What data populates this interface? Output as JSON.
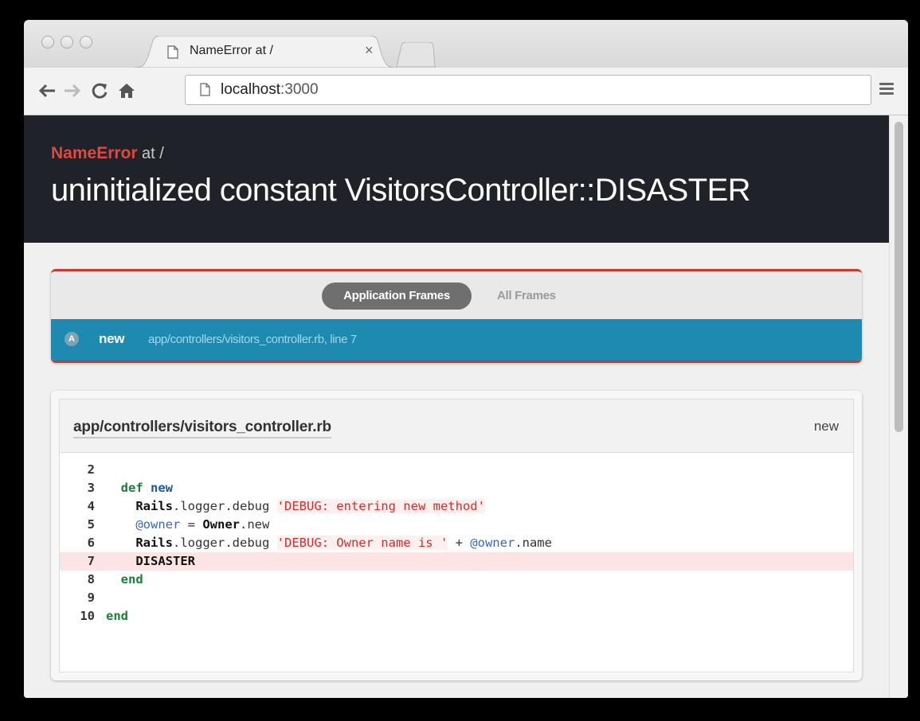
{
  "browser": {
    "tab_title": "NameError at /",
    "tab_close": "×",
    "url_host": "localhost",
    "url_port": ":3000"
  },
  "error": {
    "type": "NameError",
    "at": "at /",
    "message": "uninitialized constant VisitorsController::DISASTER"
  },
  "frames": {
    "tabs": [
      "Application Frames",
      "All Frames"
    ],
    "active_tab": "Application Frames",
    "frame": {
      "badge": "A",
      "method": "new",
      "location": "app/controllers/visitors_controller.rb, line 7"
    }
  },
  "code": {
    "file": "app/controllers/visitors_controller.rb",
    "method": "new",
    "highlight_line": "7",
    "lines": [
      {
        "num": "2"
      },
      {
        "num": "3"
      },
      {
        "num": "4"
      },
      {
        "num": "5"
      },
      {
        "num": "6"
      },
      {
        "num": "7"
      },
      {
        "num": "8"
      },
      {
        "num": "9"
      },
      {
        "num": "10"
      }
    ],
    "tokens": {
      "def": "def",
      "new": "new",
      "rails": "Rails",
      "logger_debug": ".logger.debug ",
      "str1": "'DEBUG: entering new method'",
      "owner_ivar": "@owner",
      "assign": " = ",
      "owner_const": "Owner",
      "dot_new": ".new",
      "str2": "'DEBUG: Owner name is '",
      "plus": " + ",
      "dot_name": ".name",
      "disaster": "DISASTER",
      "end": "end"
    }
  },
  "colors": {
    "error_red": "#e2473f",
    "frame_blue": "#1f8ab0",
    "header_dark": "#20222a",
    "highlight": "#fde4e4"
  }
}
